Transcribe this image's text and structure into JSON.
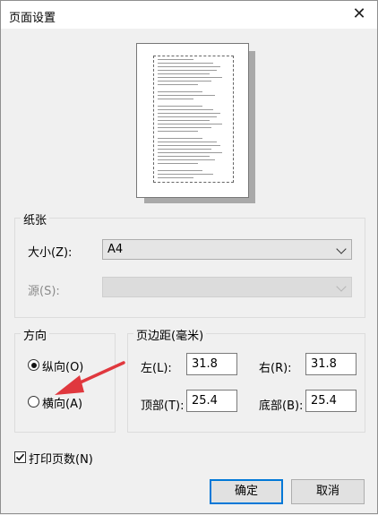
{
  "window": {
    "title": "页面设置",
    "close_icon": "close-icon"
  },
  "paper": {
    "legend": "纸张",
    "size_label": "大小(Z):",
    "size_value": "A4",
    "source_label": "源(S):",
    "source_value": ""
  },
  "orientation": {
    "legend": "方向",
    "options": [
      {
        "label": "纵向(O)",
        "selected": true
      },
      {
        "label": "横向(A)",
        "selected": false
      }
    ]
  },
  "margins": {
    "legend": "页边距(毫米)",
    "left_label": "左(L):",
    "left_value": "31.8",
    "right_label": "右(R):",
    "right_value": "31.8",
    "top_label": "顶部(T):",
    "top_value": "25.4",
    "bottom_label": "底部(B):",
    "bottom_value": "25.4"
  },
  "print_page_numbers": {
    "label": "打印页数(N)",
    "checked": true
  },
  "buttons": {
    "ok": "确定",
    "cancel": "取消"
  },
  "colors": {
    "accent": "#0078d7",
    "annotation_arrow": "#e0383e"
  }
}
